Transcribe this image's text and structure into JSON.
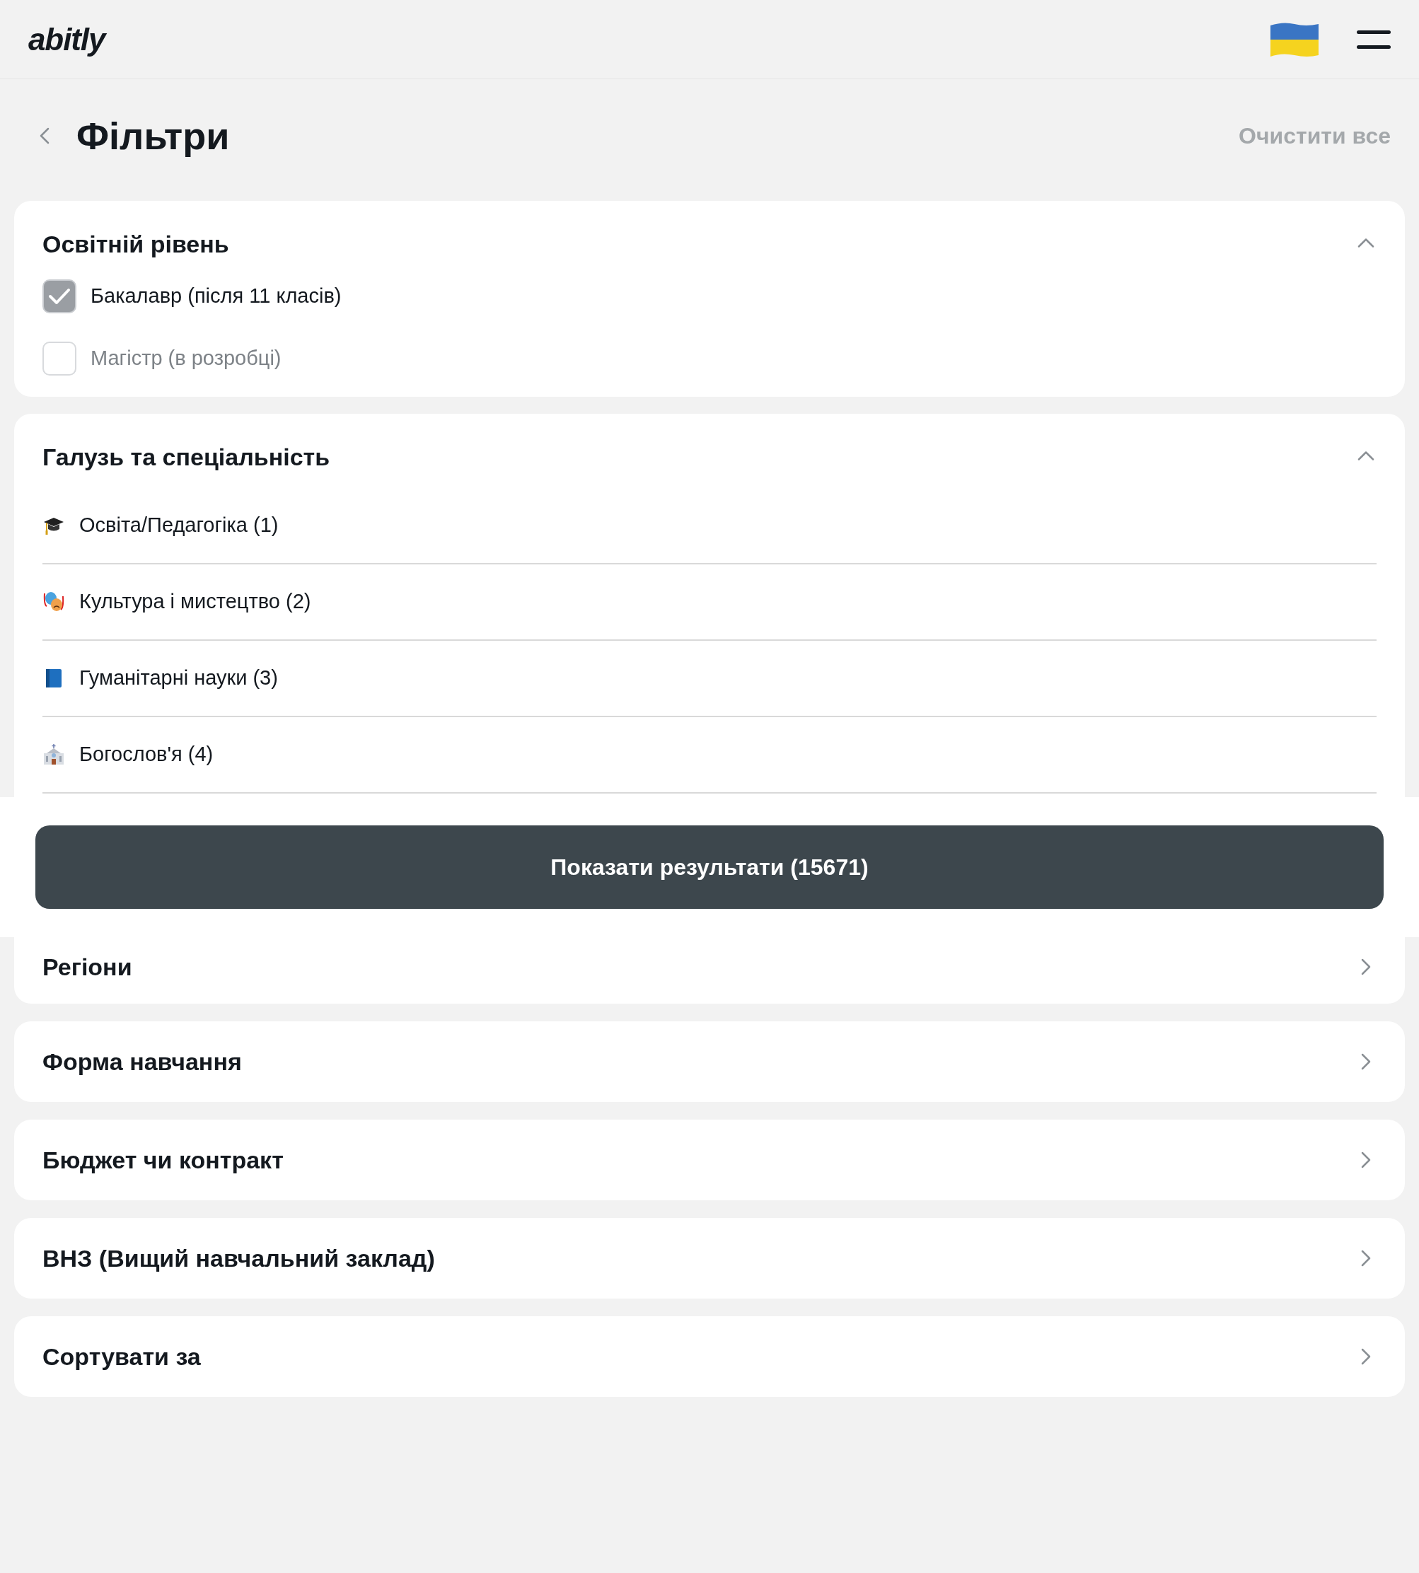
{
  "header": {
    "logo": "abitly"
  },
  "page": {
    "title": "Фільтри",
    "clear_all": "Очистити все"
  },
  "education_level": {
    "title": "Освітній рівень",
    "expanded": true,
    "options": [
      {
        "label": "Бакалавр (після 11 класів)",
        "checked": true,
        "disabled": false
      },
      {
        "label": "Магістр (в розробці)",
        "checked": false,
        "disabled": true
      }
    ]
  },
  "field_specialty": {
    "title": "Галузь та спеціальність",
    "expanded": true,
    "items": [
      {
        "kind": "cap",
        "label": "Освіта/Педагогіка (1)"
      },
      {
        "kind": "masks",
        "label": "Культура і мистецтво (2)"
      },
      {
        "kind": "book",
        "label": "Гуманітарні науки (3)"
      },
      {
        "kind": "church",
        "label": "Богослов'я (4)"
      }
    ]
  },
  "show_results_button": "Показати результати (15671)",
  "sections": [
    {
      "title": "Регіони"
    },
    {
      "title": "Форма навчання"
    },
    {
      "title": "Бюджет чи контракт"
    },
    {
      "title": "ВНЗ (Вищий навчальний заклад)"
    },
    {
      "title": "Сортувати за"
    }
  ]
}
